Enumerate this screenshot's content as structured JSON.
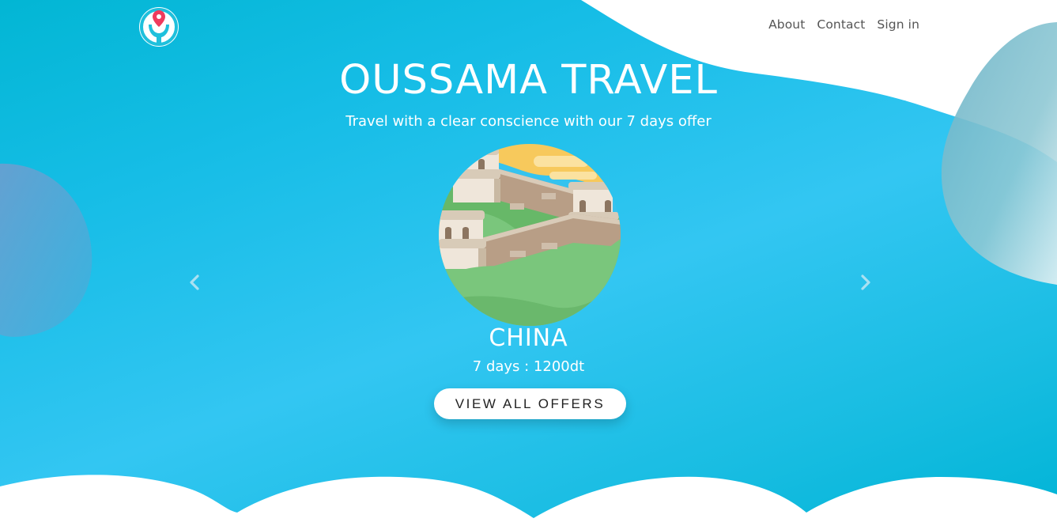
{
  "header": {
    "logo_icon": "map-pin-logo-icon",
    "nav": [
      {
        "label": "About"
      },
      {
        "label": "Contact"
      },
      {
        "label": "Sign in"
      }
    ]
  },
  "hero": {
    "title": "OUSSAMA TRAVEL",
    "subtitle": "Travel with a clear conscience with our 7 days offer"
  },
  "carousel": {
    "current": {
      "illustration": "great-wall-illustration",
      "destination": "CHINA",
      "offer": "7 days : 1200dt"
    },
    "prev_icon": "chevron-left-icon",
    "next_icon": "chevron-right-icon"
  },
  "cta": {
    "label": "VIEW ALL OFFERS"
  },
  "colors": {
    "background_start": "#02b6d4",
    "background_mid": "#33c6f2",
    "logo_ring": "#1fc0dc",
    "logo_pin": "#ef3b5d",
    "text": "#ffffff",
    "nav_text": "#555555"
  }
}
